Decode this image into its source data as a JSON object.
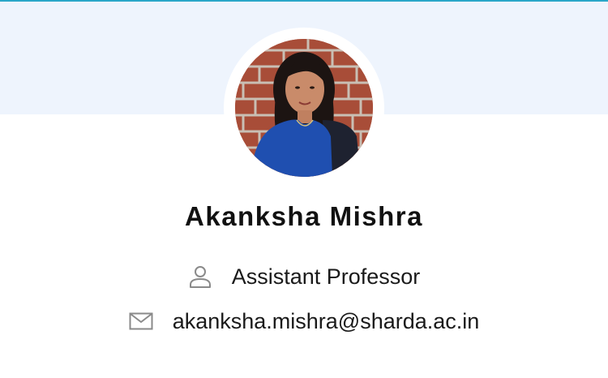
{
  "profile": {
    "name": "Akanksha Mishra",
    "designation": "Assistant Professor",
    "email": "akanksha.mishra@sharda.ac.in",
    "photo_alt": "profile photo"
  },
  "icons": {
    "designation": "person-icon",
    "email": "envelope-icon"
  },
  "colors": {
    "banner": "#eef4fd",
    "accent": "#2aa6c8",
    "text": "#111111",
    "icon": "#8a8a8a"
  }
}
